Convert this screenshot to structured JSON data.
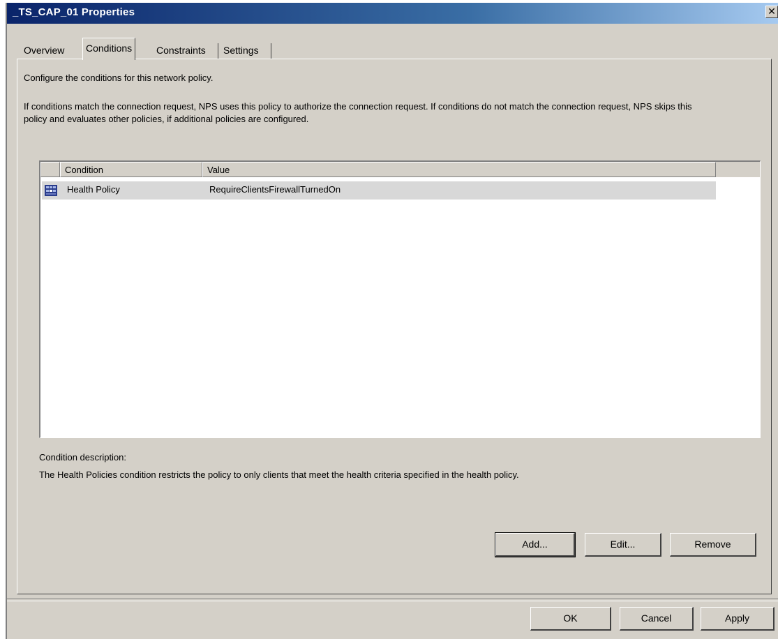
{
  "window": {
    "title": "_TS_CAP_01 Properties",
    "close_glyph": "✕"
  },
  "tabs": [
    {
      "label": "Overview"
    },
    {
      "label": "Conditions",
      "active": true
    },
    {
      "label": "Constraints"
    },
    {
      "label": "Settings"
    }
  ],
  "intro": "Configure the conditions for this network policy.",
  "explanation": "If conditions match the connection request, NPS uses this policy to authorize the connection request. If conditions do not match the connection request, NPS skips this policy and evaluates other policies, if additional policies are configured.",
  "listview": {
    "columns": [
      {
        "label": "Condition"
      },
      {
        "label": "Value"
      }
    ],
    "rows": [
      {
        "icon": "health-policy-icon",
        "condition": "Health Policy",
        "value": "RequireClientsFirewallTurnedOn",
        "selected": true
      }
    ]
  },
  "description": {
    "label": "Condition description:",
    "text": "The Health Policies condition restricts the policy to only clients that meet the health criteria specified in the health policy."
  },
  "actions": {
    "add": "Add...",
    "edit": "Edit...",
    "remove": "Remove"
  },
  "footer": {
    "ok": "OK",
    "cancel": "Cancel",
    "apply": "Apply"
  },
  "colors": {
    "title_bar": "#0a246a",
    "dialog_face": "#d4d0c8",
    "selected_row": "#d8d8d8"
  }
}
